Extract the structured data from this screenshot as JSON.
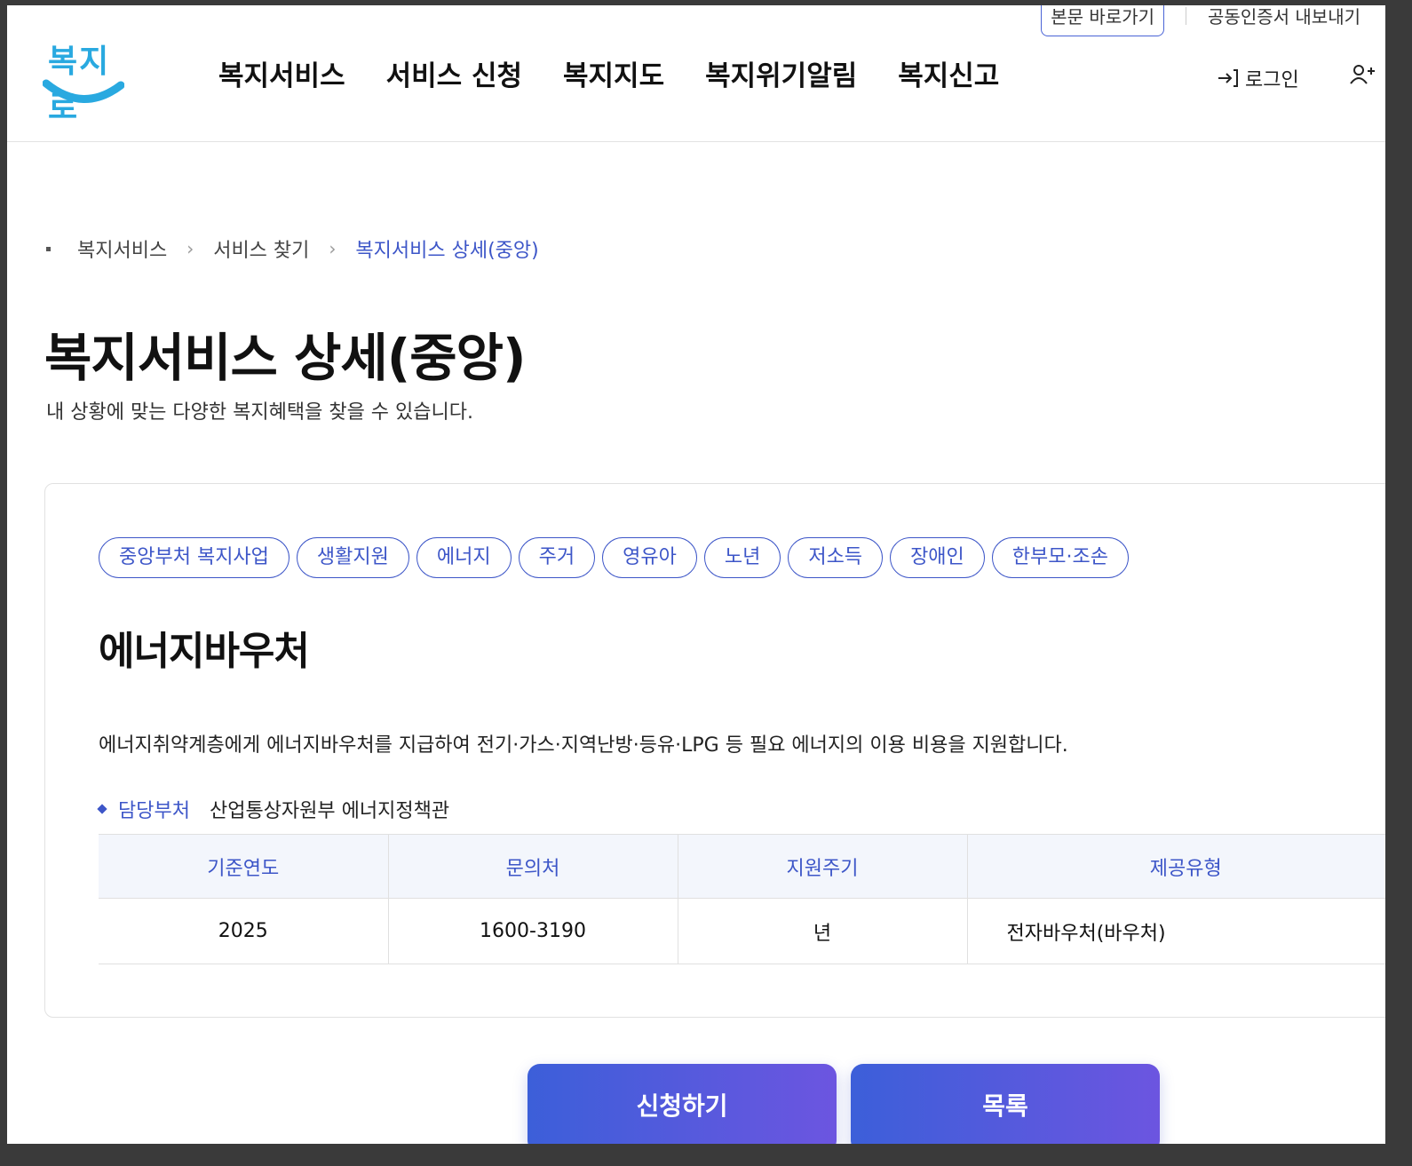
{
  "topbar": {
    "skip_label": "본문 바로가기",
    "cert_label": "공동인증서 내보내기"
  },
  "header": {
    "logo_text": "복지로",
    "nav": [
      "복지서비스",
      "서비스 신청",
      "복지지도",
      "복지위기알림",
      "복지신고"
    ],
    "login_label": "로그인",
    "login_icon": "login-arrow-icon",
    "signup_icon": "user-plus-icon"
  },
  "breadcrumb": {
    "items": [
      "복지서비스",
      "서비스 찾기",
      "복지서비스 상세(중앙)"
    ]
  },
  "page": {
    "title": "복지서비스 상세(중앙)",
    "subtitle": "내 상황에 맞는 다양한 복지혜택을 찾을 수 있습니다."
  },
  "service": {
    "tags": [
      "중앙부처 복지사업",
      "생활지원",
      "에너지",
      "주거",
      "영유아",
      "노년",
      "저소득",
      "장애인",
      "한부모·조손"
    ],
    "title": "에너지바우처",
    "description": "에너지취약계층에게 에너지바우처를 지급하여 전기·가스·지역난방·등유·LPG 등 필요 에너지의 이용 비용을 지원합니다.",
    "dept_label": "담당부처",
    "dept_value": "산업통상자원부 에너지정책관",
    "table": {
      "headers": [
        "기준연도",
        "문의처",
        "지원주기",
        "제공유형"
      ],
      "row": [
        "2025",
        "1600-3190",
        "년",
        "전자바우처(바우처)"
      ]
    }
  },
  "actions": {
    "apply_label": "신청하기",
    "list_label": "목록"
  },
  "colors": {
    "accent": "#3d56c8",
    "logo": "#29a9e0"
  }
}
